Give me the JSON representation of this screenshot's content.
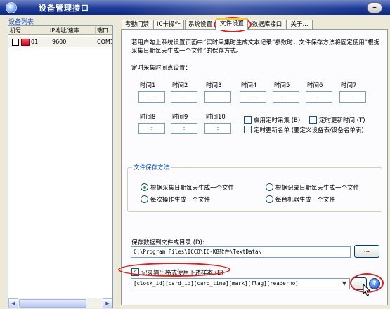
{
  "window": {
    "title": "设备管理接口",
    "minimize_label": "–"
  },
  "device_list": {
    "title": "设备列表",
    "columns": [
      "机号",
      "IP地址/速率",
      "端口"
    ],
    "rows": [
      {
        "id": "01",
        "rate": "9600",
        "port": "COM1",
        "checked": false
      }
    ]
  },
  "tabs": [
    {
      "label": "考勤门禁",
      "active": false
    },
    {
      "label": "IC卡操作",
      "active": false
    },
    {
      "label": "系统设置",
      "active": false
    },
    {
      "label": "文件设置",
      "active": true
    },
    {
      "label": "数据库接口",
      "active": false
    },
    {
      "label": "关于...",
      "active": false
    }
  ],
  "file_settings": {
    "description": "若用户勾上系统设置页面中“实时采集时生成文本记录”参数时，文件保存方法将固定使用“根据采集日期每天生成一个文件”的保存方式。",
    "timing_section_label": "定时采集时间点设置：",
    "time_slots": [
      {
        "label": "时间1",
        "value": ":"
      },
      {
        "label": "时间2",
        "value": ":"
      },
      {
        "label": "时间3",
        "value": ":"
      },
      {
        "label": "时间4",
        "value": ":"
      },
      {
        "label": "时间5",
        "value": ":"
      },
      {
        "label": "时间6",
        "value": ":"
      },
      {
        "label": "时间7",
        "value": ":"
      },
      {
        "label": "时间8",
        "value": ":"
      },
      {
        "label": "时间9",
        "value": ":"
      },
      {
        "label": "时间10",
        "value": ":"
      }
    ],
    "options": [
      {
        "label": "启用定时采集 (B)",
        "checked": false
      },
      {
        "label": "定时更新时间 (T)",
        "checked": false
      },
      {
        "label": "定时更新名单 (要定义设备表/设备名单表)",
        "checked": false
      }
    ],
    "save_method": {
      "title": "文件保存方法",
      "choices": [
        {
          "label": "根据采集日期每天生成一个文件",
          "selected": true
        },
        {
          "label": "根据记录日期每天生成一个文件",
          "selected": false
        },
        {
          "label": "每次操作生成一个文件",
          "selected": false
        },
        {
          "label": "每台机器生成一个文件",
          "selected": false
        }
      ]
    },
    "save_path_label": "保存数据到文件或目录 (D):",
    "save_path": "C:\\Program Files\\ICCO\\IC-K8软件\\TextData\\",
    "browse_label": "...",
    "format_checkbox": {
      "label": "记录输出格式使用下述样本 (E)",
      "checked": true
    },
    "format_template": "[clock_id][card_id][card_time][mark][flag][readerno]",
    "format_browse_label": "...",
    "help_label": "?"
  }
}
